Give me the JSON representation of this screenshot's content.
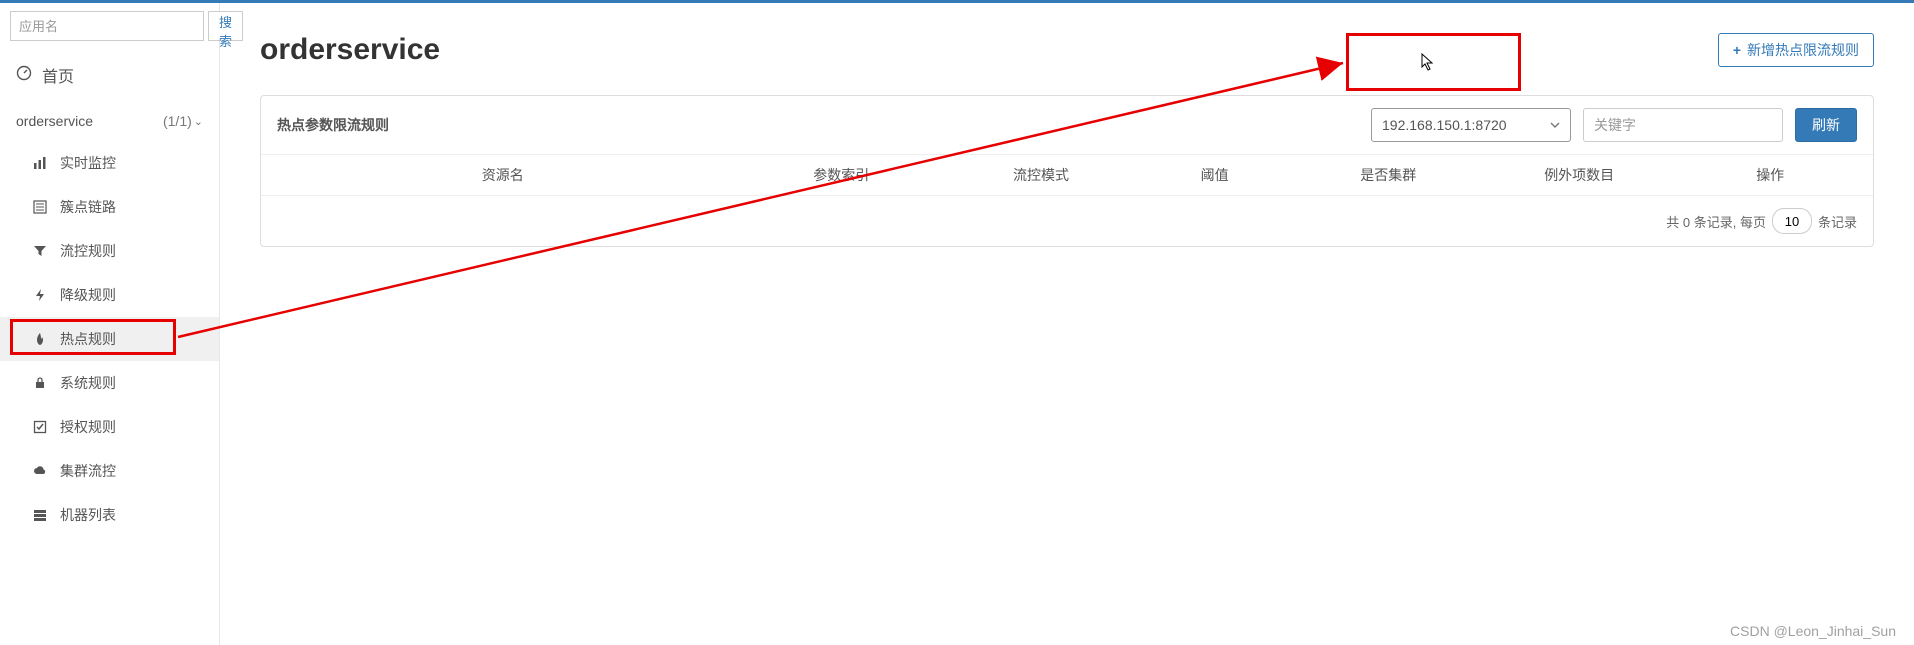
{
  "search": {
    "placeholder": "应用名",
    "button": "搜索"
  },
  "home_label": "首页",
  "app": {
    "name": "orderservice",
    "count": "(1/1)"
  },
  "menu": [
    {
      "icon": "bar-chart-icon",
      "label": "实时监控"
    },
    {
      "icon": "list-alt-icon",
      "label": "簇点链路"
    },
    {
      "icon": "filter-icon",
      "label": "流控规则"
    },
    {
      "icon": "flash-icon",
      "label": "降级规则"
    },
    {
      "icon": "fire-icon",
      "label": "热点规则"
    },
    {
      "icon": "lock-icon",
      "label": "系统规则"
    },
    {
      "icon": "check-square-icon",
      "label": "授权规则"
    },
    {
      "icon": "cloud-icon",
      "label": "集群流控"
    },
    {
      "icon": "server-icon",
      "label": "机器列表"
    }
  ],
  "page": {
    "title": "orderservice",
    "add_rule": "新增热点限流规则"
  },
  "panel": {
    "title": "热点参数限流规则",
    "node_selected": "192.168.150.1:8720",
    "keyword_placeholder": "关键字",
    "refresh": "刷新",
    "columns": [
      "资源名",
      "参数索引",
      "流控模式",
      "阈值",
      "是否集群",
      "例外项数目",
      "操作"
    ],
    "footer_prefix": "共 0 条记录, 每页",
    "page_size": "10",
    "footer_suffix": "条记录"
  },
  "watermark": "CSDN @Leon_Jinhai_Sun"
}
